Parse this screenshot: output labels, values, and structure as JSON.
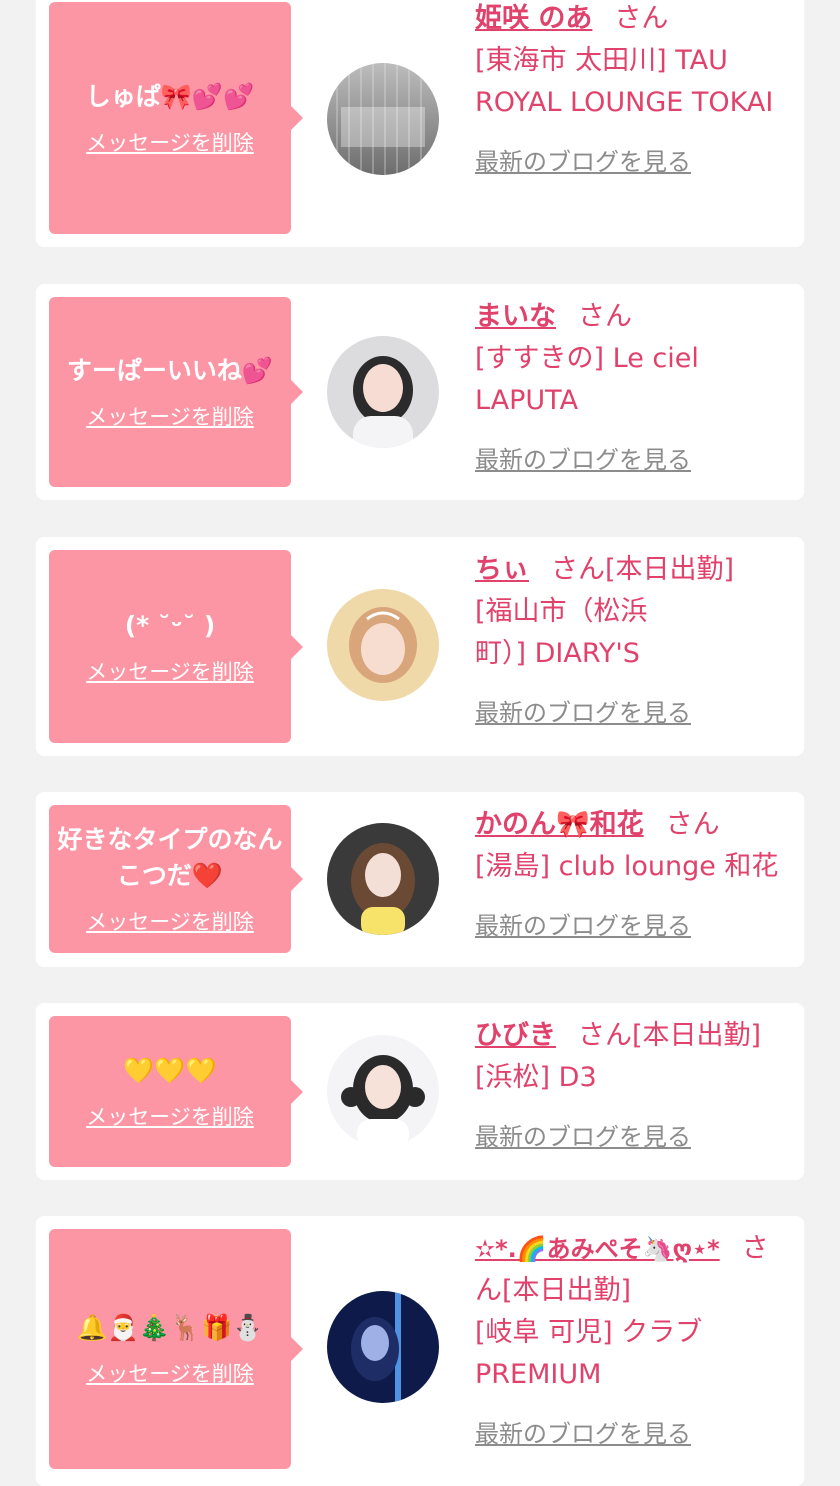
{
  "delete_label": "メッセージを削除",
  "blog_label": "最新のブログを見る",
  "san_label": "さん",
  "colors": {
    "bubble": "#fc96a5",
    "name": "#e0426c",
    "link_gray": "#8c8c8c",
    "background": "#f2f2f2"
  },
  "entries": [
    {
      "message": "しゅぱ🎀💕💕",
      "name": "姫咲 のあ",
      "shift": "",
      "shop": "[東海市 太田川] TAU ROYAL LOUNGE TOKAI"
    },
    {
      "message": "すーぱーいいね💕",
      "name": "まいな",
      "shift": "",
      "shop": "[すすきの] Le ciel LAPUTA"
    },
    {
      "message": "(* ˘ᵕ˘ )",
      "name": "ちぃ",
      "shift": "[本日出勤]",
      "shop": "[福山市（松浜町）] DIARY'S"
    },
    {
      "message": "好きなタイプのなんこつだ❤️",
      "name": "かのん🎀和花",
      "shift": "",
      "shop": "[湯島] club lounge 和花"
    },
    {
      "message": "💛💛💛",
      "name": "ひびき",
      "shift": "[本日出勤]",
      "shop": "[浜松] D3"
    },
    {
      "message": "🔔🎅🎄🦌🎁⛄",
      "name": "✫*.🌈あみぺそ🦄ღ⋆*",
      "shift": "[本日出勤]",
      "shop": "[岐阜 可児] クラブPREMIUM"
    }
  ]
}
